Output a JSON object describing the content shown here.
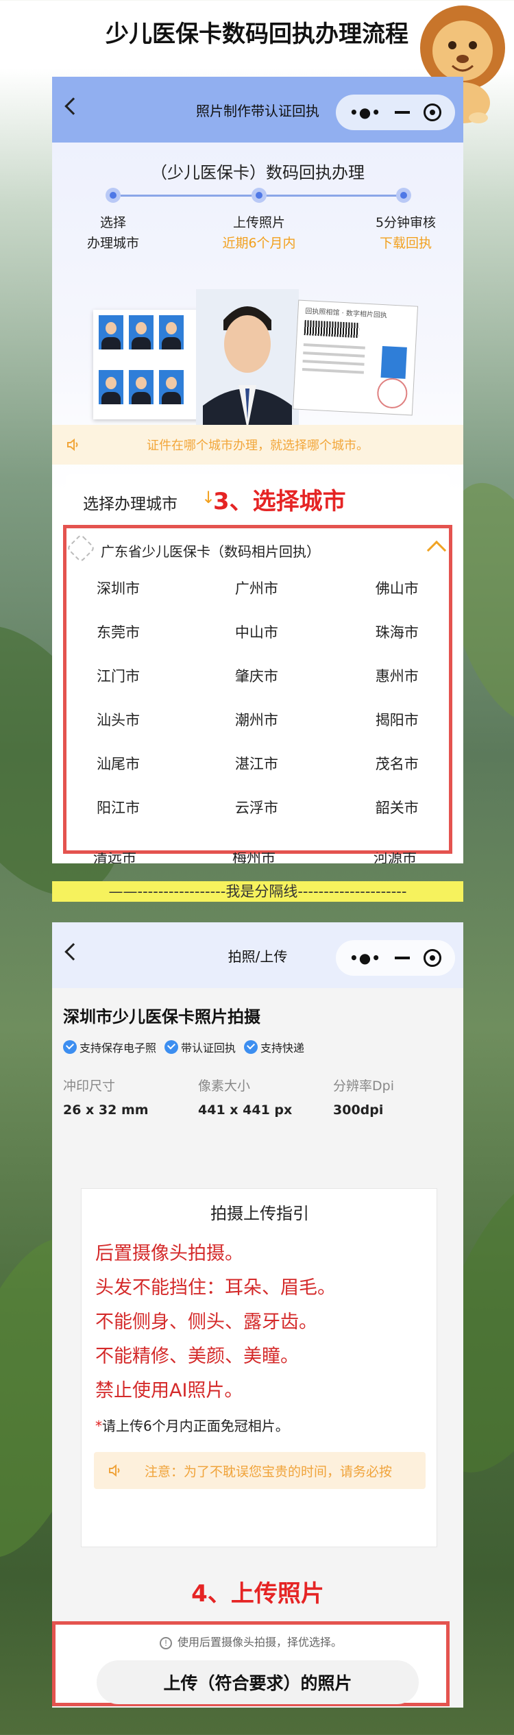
{
  "page": {
    "title": "少儿医保卡数码回执办理流程"
  },
  "screen1": {
    "nav_title": "照片制作带认证回执",
    "capsule_more": "•●•",
    "hero_title": "（少儿医保卡）数码回执办理",
    "steps": [
      {
        "line1": "选择",
        "line2": "办理城市"
      },
      {
        "line1": "上传照片",
        "line2": "近期6个月内"
      },
      {
        "line1": "5分钟审核",
        "line2": "下载回执"
      }
    ],
    "receipt_title": "回执照相馆 · 数字相片回执",
    "notice": "证件在哪个城市办理，就选择哪个城市。",
    "select_city_label": "选择办理城市",
    "select_city_arrow": "↓",
    "annotation": "3、选择城市",
    "province": "广东省少儿医保卡（数码相片回执）",
    "cities": [
      [
        "深圳市",
        "广州市",
        "佛山市"
      ],
      [
        "东莞市",
        "中山市",
        "珠海市"
      ],
      [
        "江门市",
        "肇庆市",
        "惠州市"
      ],
      [
        "汕头市",
        "潮州市",
        "揭阳市"
      ],
      [
        "汕尾市",
        "湛江市",
        "茂名市"
      ],
      [
        "阳江市",
        "云浮市",
        "韶关市"
      ],
      [
        "清远市",
        "梅州市",
        "河源市"
      ]
    ]
  },
  "divider": "——-----------------我是分隔线---------------------",
  "screen2": {
    "nav_title": "拍照/上传",
    "capsule_more": "•●•",
    "title": "深圳市少儿医保卡照片拍摄",
    "tags": [
      "支持保存电子照",
      "带认证回执",
      "支持快递"
    ],
    "specs": [
      {
        "label": "冲印尺寸",
        "value": "26 x 32 mm"
      },
      {
        "label": "像素大小",
        "value": "441 x 441 px"
      },
      {
        "label": "分辨率Dpi",
        "value": "300dpi"
      }
    ],
    "guide_title": "拍摄上传指引",
    "rules": [
      "后置摄像头拍摄。",
      "头发不能挡住：耳朵、眉毛。",
      "不能侧身、侧头、露牙齿。",
      "不能精修、美颜、美瞳。",
      "禁止使用AI照片。"
    ],
    "sub_note_star": "*",
    "sub_note": "请上传6个月内正面免冠相片。",
    "warning": "注意：为了不耽误您宝贵的时间，请务必按",
    "annotation": "4、上传照片",
    "upload_tip_icon": "!",
    "upload_tip": "使用后置摄像头拍摄，择优选择。",
    "upload_button": "上传（符合要求）的照片"
  },
  "colors": {
    "annotation_red": "#e52424",
    "accent_orange": "#f2a01e",
    "nav_blue": "#91aff0",
    "divider_yellow": "#f6f25d"
  }
}
